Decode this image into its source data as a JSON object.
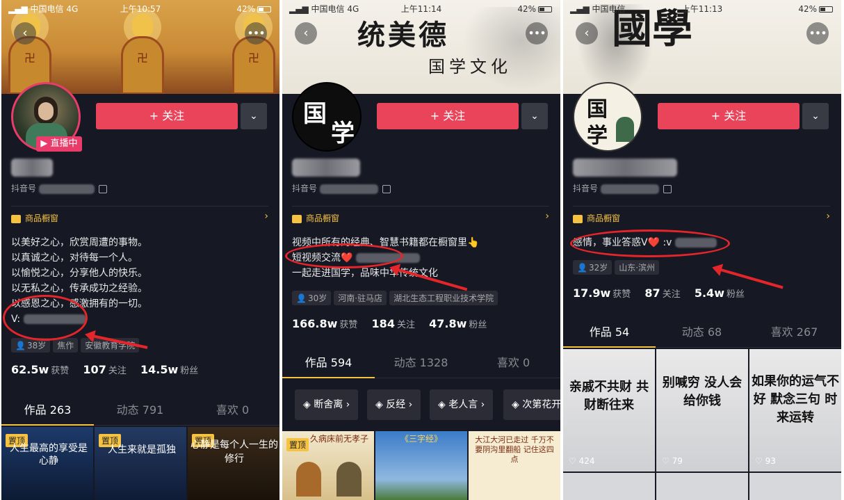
{
  "status": {
    "carrier": "中国电信",
    "network": "4G",
    "battery": "42%",
    "time1": "上午10:57",
    "time2": "上午11:14",
    "time3": "上午11:13"
  },
  "common": {
    "follow_label": "+ 关注",
    "shop_label": "商品橱窗",
    "douyin_id_label": "抖音号",
    "likes_label": "获赞",
    "following_label": "关注",
    "fans_label": "粉丝",
    "pinned_label": "置顶"
  },
  "profile1": {
    "live_badge": "▶ 直播中",
    "bio": [
      "以美好之心，欣赏周遭的事物。",
      "以真诚之心，对待每一个人。",
      "以愉悦之心，分享他人的快乐。",
      "以无私之心，传承成功之经验。",
      "以感恩之心，感激拥有的一切。",
      "V:"
    ],
    "tags": [
      "38岁",
      "焦作",
      "安徽教育学院"
    ],
    "stats": {
      "likes": "62.5w",
      "following": "107",
      "fans": "14.5w"
    },
    "tabs": [
      "作品 263",
      "动态 791",
      "喜欢 0"
    ],
    "videos": [
      {
        "caption": "人生最高的享受是心静"
      },
      {
        "caption": "人生来就是孤独"
      },
      {
        "caption": "心静是每个人一生的修行"
      }
    ]
  },
  "profile2": {
    "banner_text_1": "统美德",
    "banner_text_2": "国学文化",
    "avatar_chars": [
      "国",
      "学"
    ],
    "bio": [
      "视频中所有的经典、智慧书籍都在橱窗里👆",
      "短视频交流❤️",
      "一起走进国学，品味中华传统文化"
    ],
    "tags": [
      "30岁",
      "河南·驻马店",
      "湖北生态工程职业技术学院"
    ],
    "stats": {
      "likes": "166.8w",
      "following": "184",
      "fans": "47.8w"
    },
    "tabs": [
      "作品 594",
      "动态 1328",
      "喜欢 0"
    ],
    "collections": [
      "断舍离 ›",
      "反经 ›",
      "老人言 ›",
      "次第花开"
    ],
    "videos": [
      {
        "caption": "久病床前无孝子"
      },
      {
        "caption": "《三字经》"
      },
      {
        "caption": "大江大河已走过 千万不要阴沟里翻船 记住这四点"
      }
    ]
  },
  "profile3": {
    "banner_text": "國學",
    "avatar_chars": [
      "国",
      "学"
    ],
    "bio": [
      "感情，事业答惑V❤️ :v"
    ],
    "tags": [
      "32岁",
      "山东·滨州"
    ],
    "stats": {
      "likes": "17.9w",
      "following": "87",
      "fans": "5.4w"
    },
    "tabs": [
      "作品 54",
      "动态 68",
      "喜欢 267"
    ],
    "videos": [
      {
        "caption": "亲戚不共财 共财断往来",
        "likes": "424"
      },
      {
        "caption": "别喊穷 没人会给你钱",
        "likes": "79"
      },
      {
        "caption": "如果你的运气不好 默念三句 时来运转",
        "likes": "93"
      }
    ]
  },
  "colors": {
    "follow": "#e9445a",
    "background": "#161823",
    "accent": "#f5c242",
    "annotation": "#e4262b",
    "live": "#e93c6b"
  }
}
